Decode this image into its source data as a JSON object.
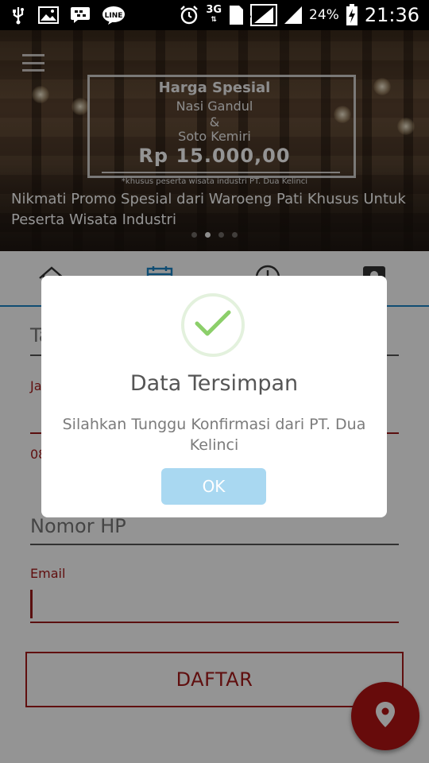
{
  "status_bar": {
    "left_icons": [
      "usb-icon",
      "image-icon",
      "bbm-icon",
      "line-app-icon"
    ],
    "network_label": "3G",
    "sim_label": "1",
    "battery_pct": "24%",
    "time": "21:36"
  },
  "banner": {
    "promo_title": "Harga Spesial",
    "promo_line1": "Nasi Gandul",
    "promo_amp": "&",
    "promo_line2": "Soto Kemiri",
    "promo_price": "Rp 15.000,00",
    "promo_note": "*khusus peserta wisata industri PT. Dua Kelinci",
    "caption": "Nikmati Promo Spesial dari Waroeng Pati Khusus Untuk Peserta Wisata Industri",
    "active_dot": 1,
    "dot_count": 4
  },
  "tabs": [
    {
      "icon": "home-icon"
    },
    {
      "icon": "calendar-icon"
    },
    {
      "icon": "clock-icon"
    },
    {
      "icon": "contact-icon"
    }
  ],
  "form": {
    "field1_partial": "Ta",
    "field2_label_partial": "Ja",
    "field3_value_partial": "08",
    "phone_placeholder": "Nomor HP",
    "email_label": "Email",
    "submit_label": "DAFTAR"
  },
  "dialog": {
    "title": "Data Tersimpan",
    "message": "Silahkan Tunggu Konfirmasi dari PT. Dua Kelinci",
    "ok_label": "OK"
  },
  "colors": {
    "accent_blue": "#1d86c7",
    "brand_red": "#a61b1b",
    "ok_button": "#a9d8f1",
    "success_green": "#8ccf6a"
  }
}
